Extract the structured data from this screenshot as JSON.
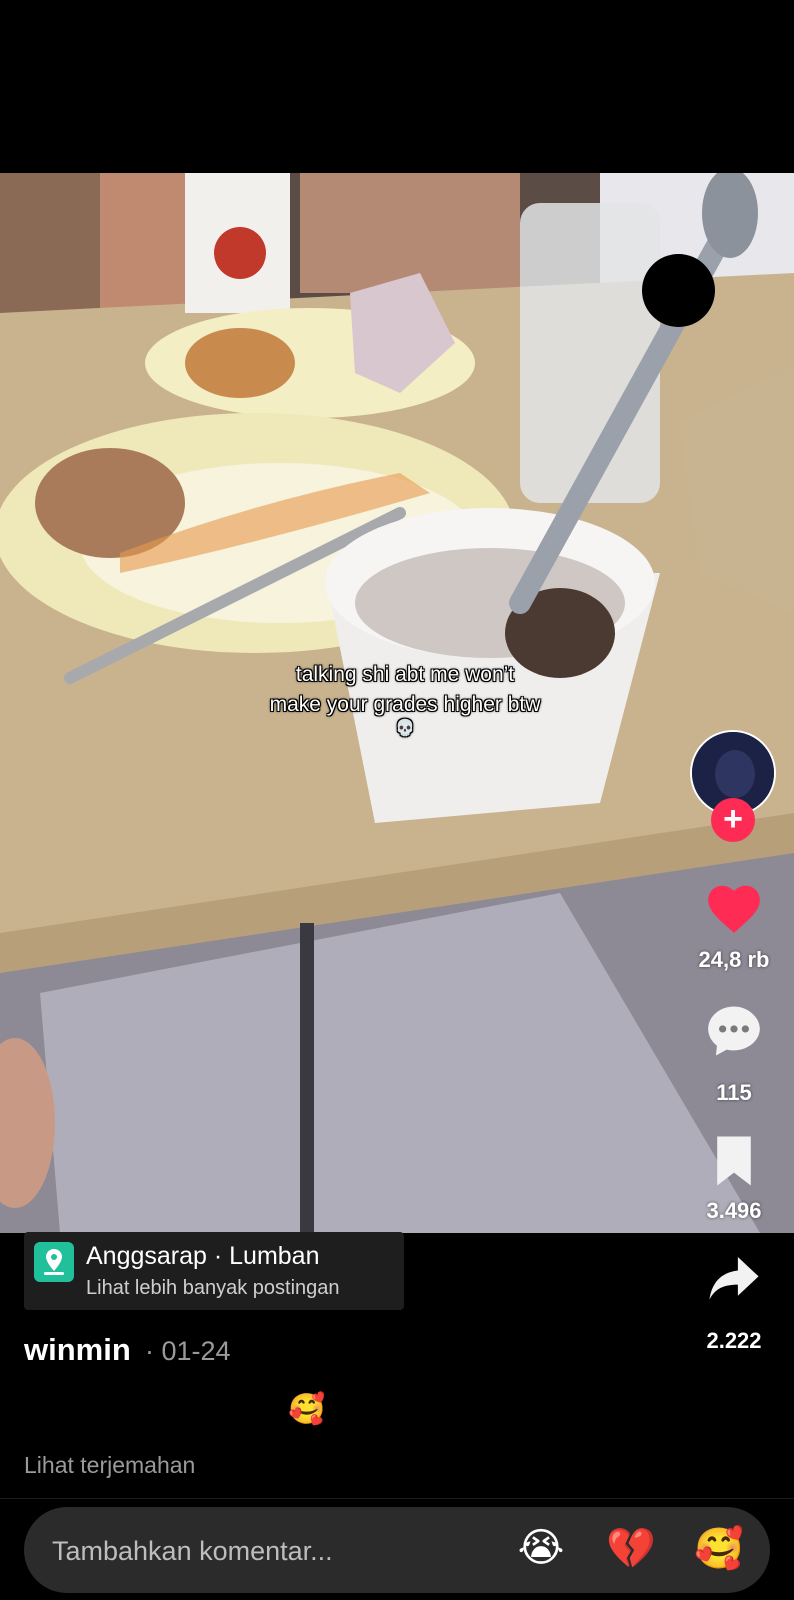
{
  "video": {
    "caption_line1": "talking shi abt me won’t",
    "caption_line2": "make your grades higher btw",
    "caption_emoji": "💀"
  },
  "actions": {
    "likes": "24,8 rb",
    "comments": "115",
    "bookmarks": "3.496",
    "shares": "2.222",
    "follow_symbol": "+",
    "like_color": "#fe2c55"
  },
  "location": {
    "title": "Anggsarap · Lumban",
    "subtitle": "Lihat lebih banyak postingan"
  },
  "post": {
    "username": "winmin",
    "date": "· 01-24",
    "description": "🥰",
    "translate_label": "Lihat terjemahan"
  },
  "comment_bar": {
    "placeholder": "Tambahkan komentar...",
    "emoji_1": "😭",
    "emoji_2": "💔",
    "emoji_3": "🥰"
  }
}
